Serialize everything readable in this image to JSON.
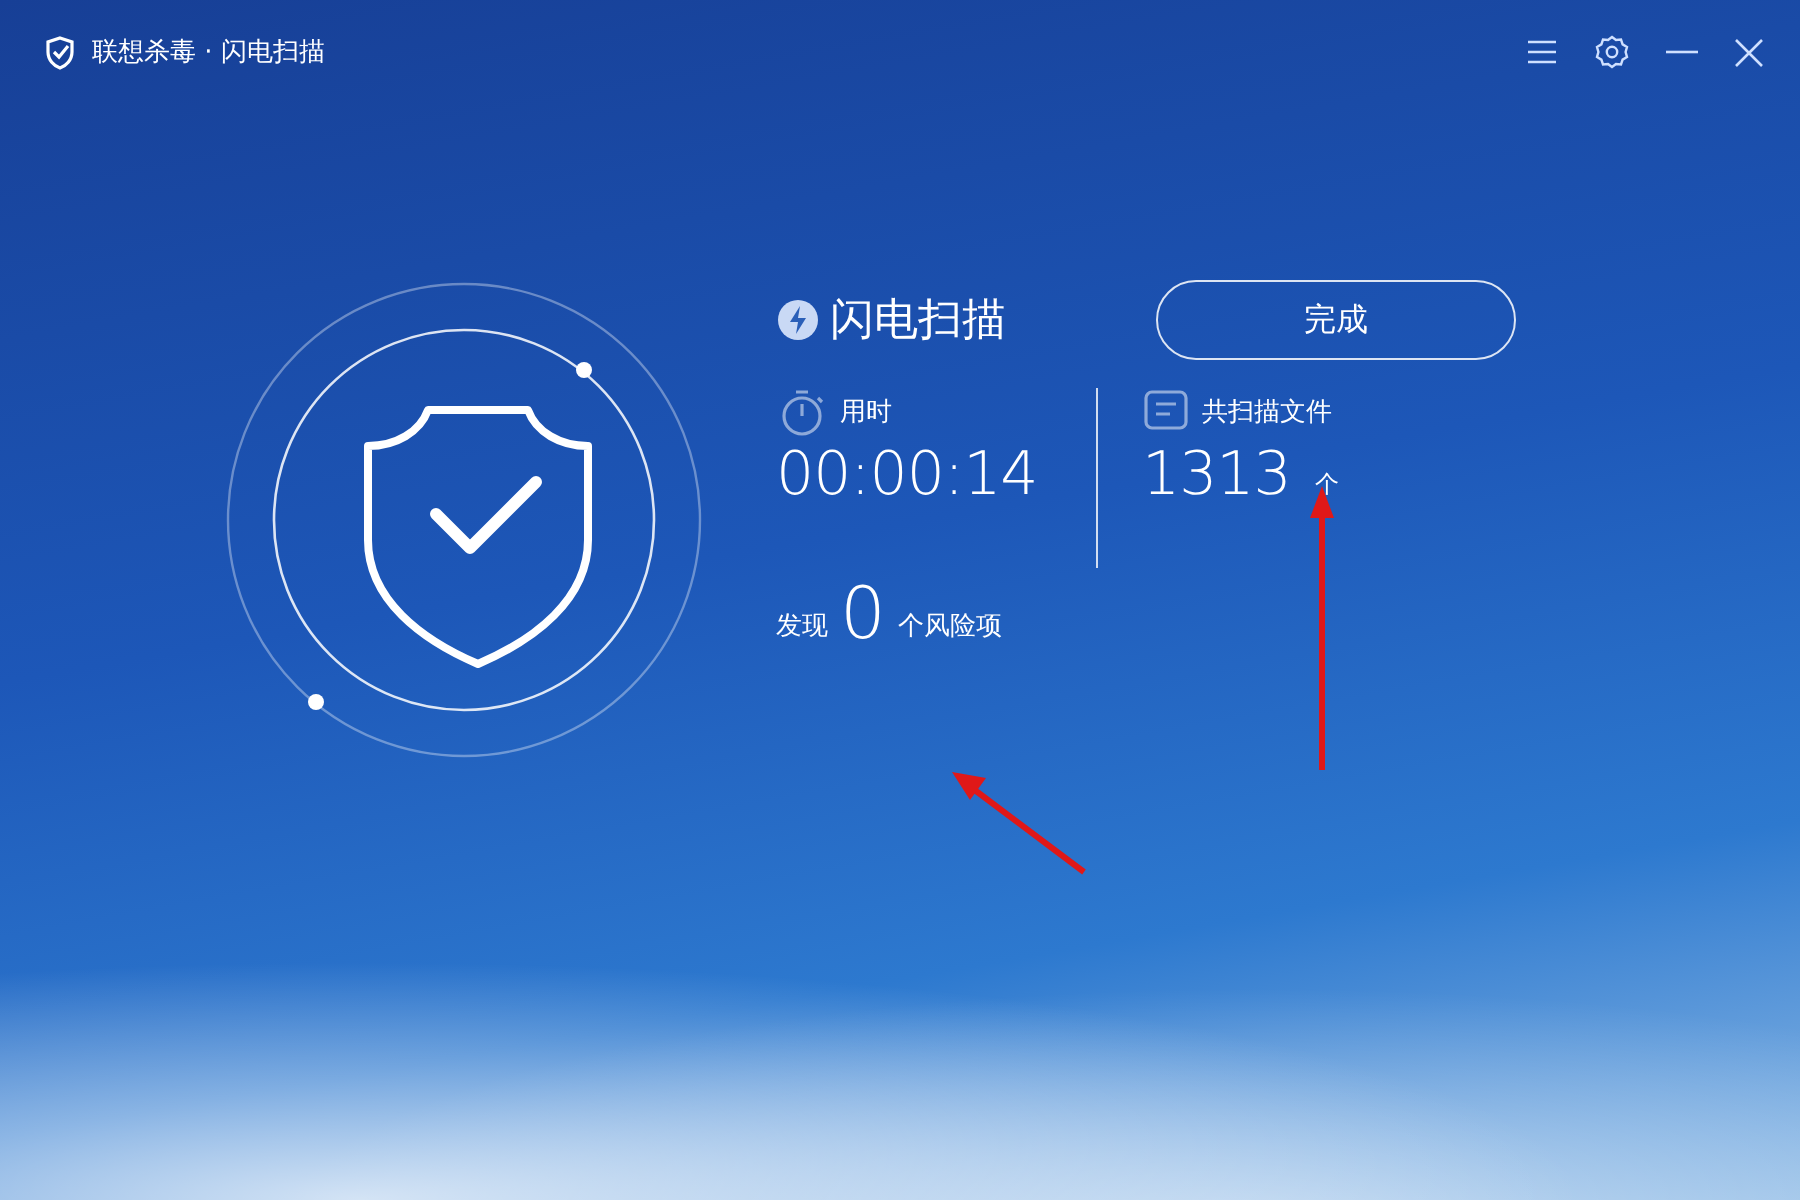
{
  "window": {
    "title": "联想杀毒 · 闪电扫描"
  },
  "scan": {
    "title": "闪电扫描",
    "done_button": "完成",
    "elapsed": {
      "label": "用时",
      "value": "00:00:14"
    },
    "files": {
      "label": "共扫描文件",
      "value": "1313",
      "unit": "个"
    },
    "found": {
      "prefix": "发现",
      "count": "0",
      "suffix": "个风险项"
    }
  }
}
